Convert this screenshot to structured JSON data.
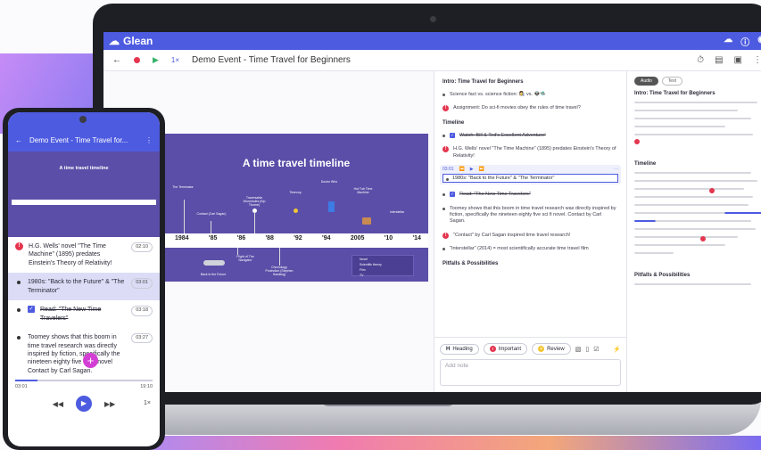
{
  "app": {
    "name": "Glean",
    "accent": "#4d5be0",
    "record_color": "#e4364f"
  },
  "toolbar": {
    "speed": "1×",
    "title": "Demo Event - Time Travel for Beginners"
  },
  "slide": {
    "title": "A time travel timeline",
    "years": [
      "1984",
      "'85",
      "'86",
      "'88",
      "'92",
      "'94",
      "2005",
      "'10",
      "'14"
    ],
    "labels": [
      "The Terminator",
      "Contact (Carl Sagan)",
      "Traversable Wormholes (Kip Thorne)",
      "Timecop",
      "Doctor Who",
      "Hot Tub Time Machine",
      "Interstellar",
      "Flight of The Navigator",
      "Chronology Protection (Stephen Hawking)",
      "Back to the Future"
    ],
    "legend": [
      "Novel",
      "Scientific theory",
      "Film",
      "TV"
    ]
  },
  "notes": {
    "section1": "Intro: Time Travel for Beginners",
    "item1": "Science fact vs. science fiction: 👩‍🔬 vs. 👽🛸",
    "item2": "Assignment: Do sci-fi movies obey the rules of time travel?",
    "section2": "Timeline",
    "item3": "Watch: Bill & Ted's Excellent Adventure!",
    "item4": "H.G. Wells' novel \"The Time Machine\" (1895) predates Einstein's Theory of Relativity!",
    "edit_time": "03:01",
    "edit_text": "1980s: \"Back to the Future\" & \"The Terminator\"",
    "item5": "Read: \"The New Time Travelers\"",
    "item6": "Toomey shows that this boom in time travel research was directly inspired by fiction, specifically the nineteen eighty five sci fi novel. Contact by Carl Sagan.",
    "item7": "\"Contact\" by Carl Sagan inspired time travel research!",
    "item8": "\"Interstellar\" (2014) = most scientifically accurate time travel film",
    "section3": "Pitfalls & Possibilities"
  },
  "compose": {
    "chip_heading": "Heading",
    "chip_important": "Important",
    "chip_review": "Review",
    "placeholder": "Add note"
  },
  "transcript": {
    "tab_audio": "Audio",
    "tab_text": "Text",
    "h1": "Intro: Time Travel for Beginners",
    "h2": "Timeline",
    "h3": "Pitfalls & Possibilities"
  },
  "phone": {
    "title": "Demo Event - Time Travel for...",
    "slide_title": "A time travel timeline",
    "items": [
      {
        "text": "H.G. Wells' novel \"The Time Machine\" (1895) predates Einstein's Theory of Relativity!",
        "time": "02:10"
      },
      {
        "text": "1980s: \"Back to the Future\" & \"The Terminator\"",
        "time": "03:01"
      },
      {
        "text": "Read: \"The New Time Travelers\"",
        "time": "03:18"
      },
      {
        "text": "Toomey shows that this boom in time travel research was directly inspired by fiction, specifically the nineteen eighty five sci fi novel Contact by Carl Sagan.",
        "time": "03:27"
      }
    ],
    "elapsed": "03:01",
    "total": "19:10",
    "speed": "1×",
    "progress": 0.16
  }
}
